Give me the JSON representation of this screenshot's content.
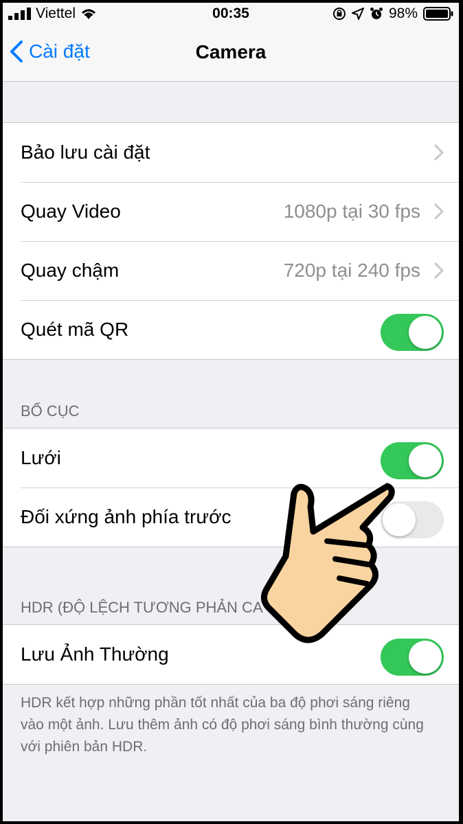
{
  "status_bar": {
    "carrier": "Viettel",
    "time": "00:35",
    "battery_percent": "98%",
    "icons": [
      "signal-bars-icon",
      "wifi-icon",
      "orientation-lock-icon",
      "location-icon",
      "alarm-icon",
      "battery-icon"
    ]
  },
  "nav": {
    "back_label": "Cài đặt",
    "title": "Camera"
  },
  "group1": {
    "rows": [
      {
        "label": "Bảo lưu cài đặt",
        "value": ""
      },
      {
        "label": "Quay Video",
        "value": "1080p tại 30 fps"
      },
      {
        "label": "Quay chậm",
        "value": "720p tại 240 fps"
      },
      {
        "label": "Quét mã QR",
        "toggle_on": true
      }
    ]
  },
  "layout_section": {
    "header": "BỐ CỤC",
    "rows": [
      {
        "label": "Lưới",
        "toggle_on": true
      },
      {
        "label": "Đối xứng ảnh phía trước",
        "toggle_on": false
      }
    ]
  },
  "hdr_section": {
    "header": "HDR (ĐỘ LỆCH TƯƠNG PHẢN CA",
    "rows": [
      {
        "label": "Lưu Ảnh Thường",
        "toggle_on": true
      }
    ],
    "footer": "HDR kết hợp những phần tốt nhất của ba độ phơi sáng riêng vào một ảnh. Lưu thêm ảnh có độ phơi sáng bình thường cùng với phiên bản HDR."
  },
  "colors": {
    "accent": "#007aff",
    "toggle_on": "#34c759",
    "background": "#efeff4",
    "hand_fill": "#f9d4a0"
  }
}
